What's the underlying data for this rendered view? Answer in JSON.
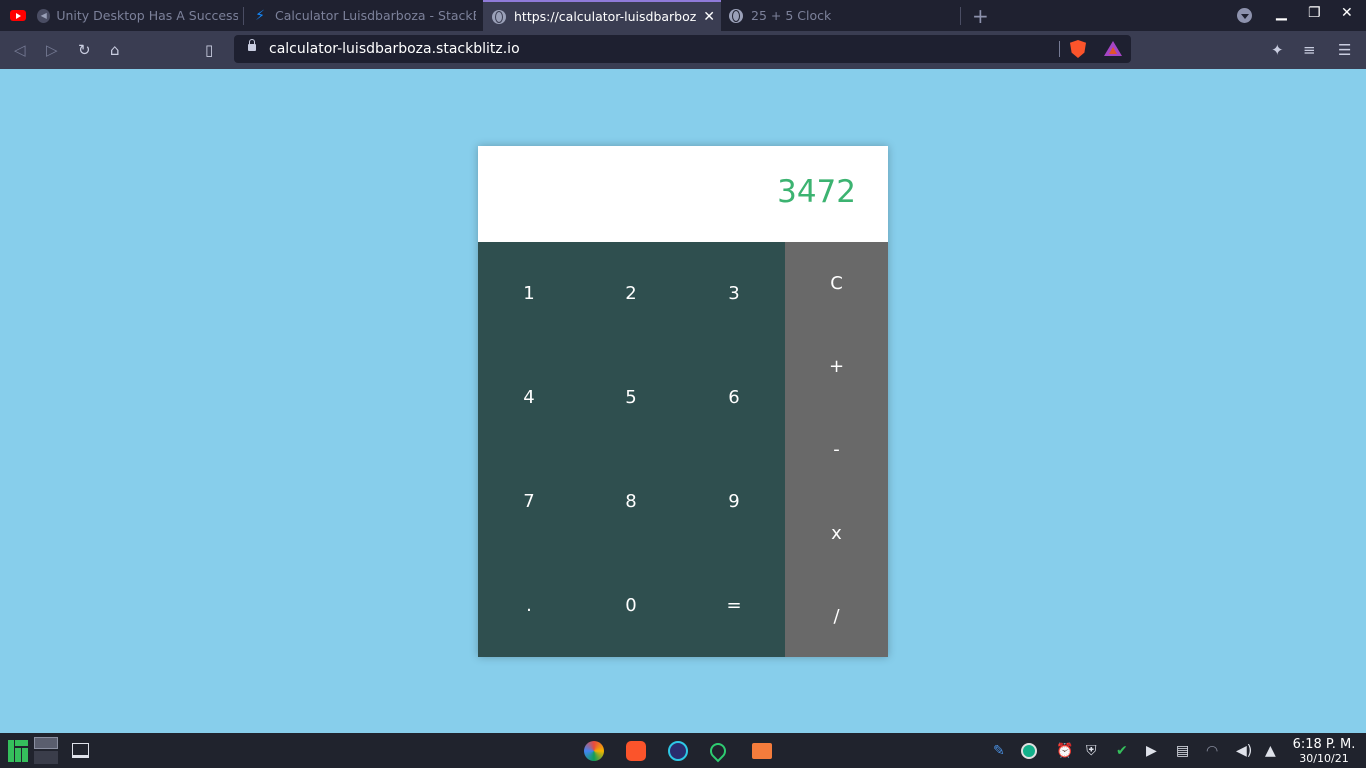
{
  "browser": {
    "tabs": [
      {
        "title": "Unity Desktop Has A Successo",
        "icon": "youtube-icon",
        "muted": true,
        "active": false
      },
      {
        "title": "Calculator Luisdbarboza - StackBl",
        "icon": "stackblitz-bolt-icon",
        "active": false
      },
      {
        "title": "https://calculator-luisdbarboz",
        "icon": "globe-icon",
        "active": true
      },
      {
        "title": "25 + 5 Clock",
        "icon": "globe-icon",
        "active": false
      }
    ],
    "address_url": "calculator-luisdbarboza.stackblitz.io",
    "accent_color": "#8f7bd9"
  },
  "calculator": {
    "display": "3472",
    "display_color": "#3cb371",
    "numpad_color": "#2f4f4f",
    "ops_color": "#696969",
    "number_keys": [
      "1",
      "2",
      "3",
      "4",
      "5",
      "6",
      "7",
      "8",
      "9",
      ".",
      "0",
      "="
    ],
    "operator_keys": [
      "C",
      "+",
      "-",
      "x",
      "/"
    ]
  },
  "page": {
    "background": "#87ceeb"
  },
  "taskbar": {
    "time": "6:18 P. M.",
    "date": "30/10/21"
  }
}
